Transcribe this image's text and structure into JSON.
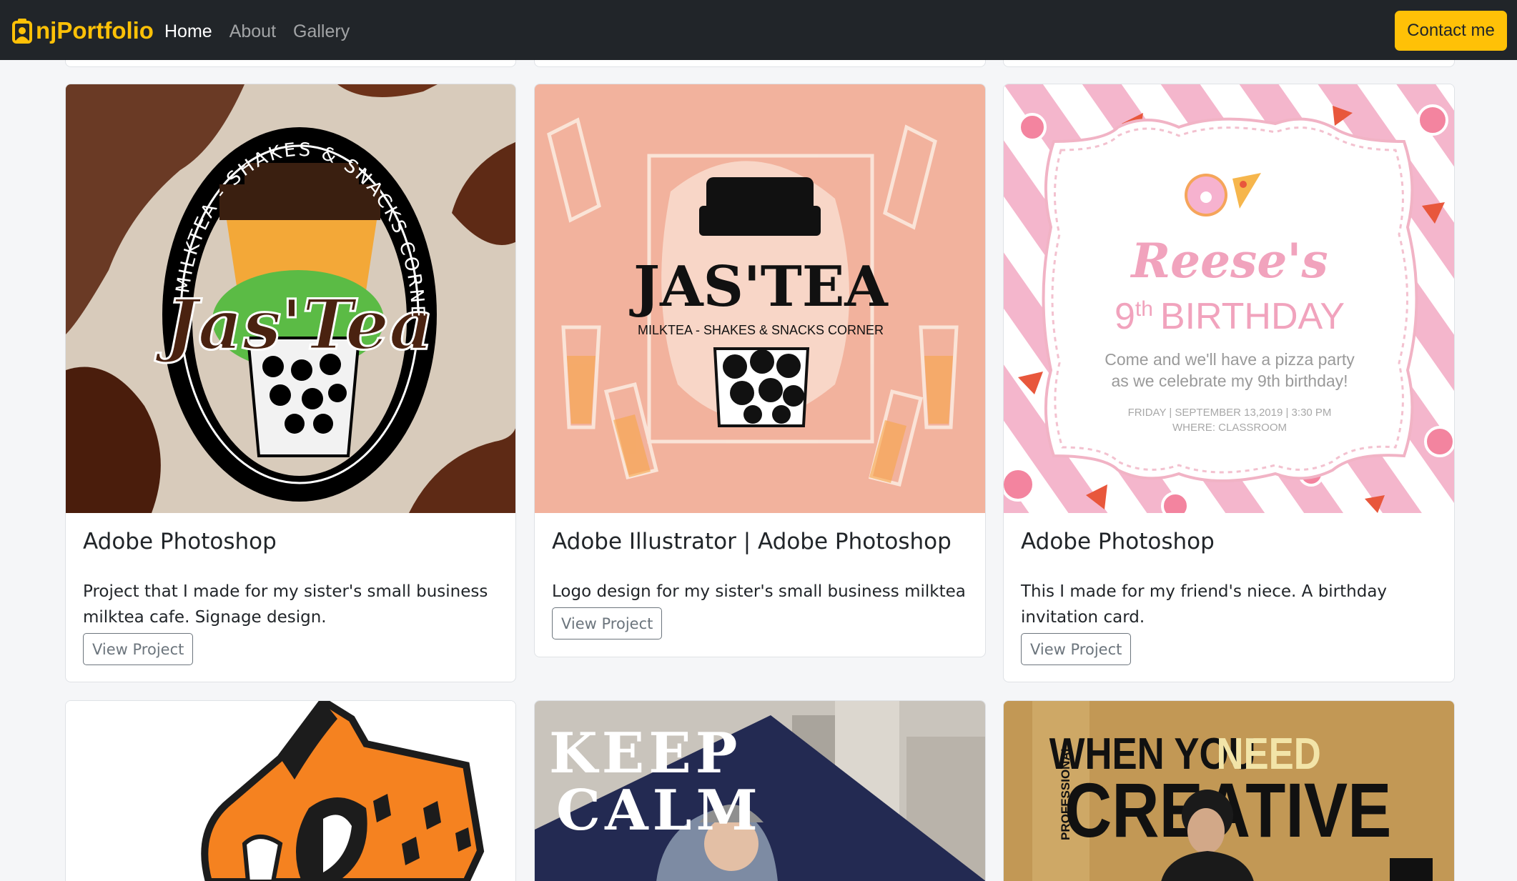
{
  "navbar": {
    "brand": "njPortfolio",
    "links": [
      "Home",
      "About",
      "Gallery"
    ],
    "contact_label": "Contact me",
    "brand_color": "#ffc107"
  },
  "cards": [
    {
      "title": "Adobe Photoshop",
      "text": "Project that I made for my sister's small business milktea cafe. Signage design.",
      "button": "View Project",
      "image": {
        "ring_text": "MILKTEA - SHAKES & SNACKS CORNER",
        "logo_text": "Jas'Tea"
      }
    },
    {
      "title": "Adobe Illustrator | Adobe Photoshop",
      "text": "Logo design for my sister's small business milktea cafe.",
      "button": "View Project",
      "image": {
        "logo_text": "JAS'TEA",
        "subtitle": "MILKTEA - SHAKES & SNACKS CORNER"
      }
    },
    {
      "title": "Adobe Photoshop",
      "text": "This I made for my friend's niece. A birthday invitation card.",
      "button": "View Project",
      "image": {
        "name": "Reese's",
        "ordinal_num": "9",
        "ordinal_suffix": "th",
        "heading": "BIRTHDAY",
        "line1": "Come and we'll have a pizza party",
        "line2": "as we celebrate my 9th birthday!",
        "details1": "FRIDAY | SEPTEMBER 13,2019 | 3:30 PM",
        "details2": "WHERE: CLASSROOM"
      }
    }
  ],
  "row2": [
    {
      "image_text": ""
    },
    {
      "line1": "KEEP",
      "line2": "CALM"
    },
    {
      "line1a": "WHEN YOU",
      "line1b": "NEED",
      "line2": "CREATIVE",
      "side": "PROFESSIONAL"
    }
  ]
}
